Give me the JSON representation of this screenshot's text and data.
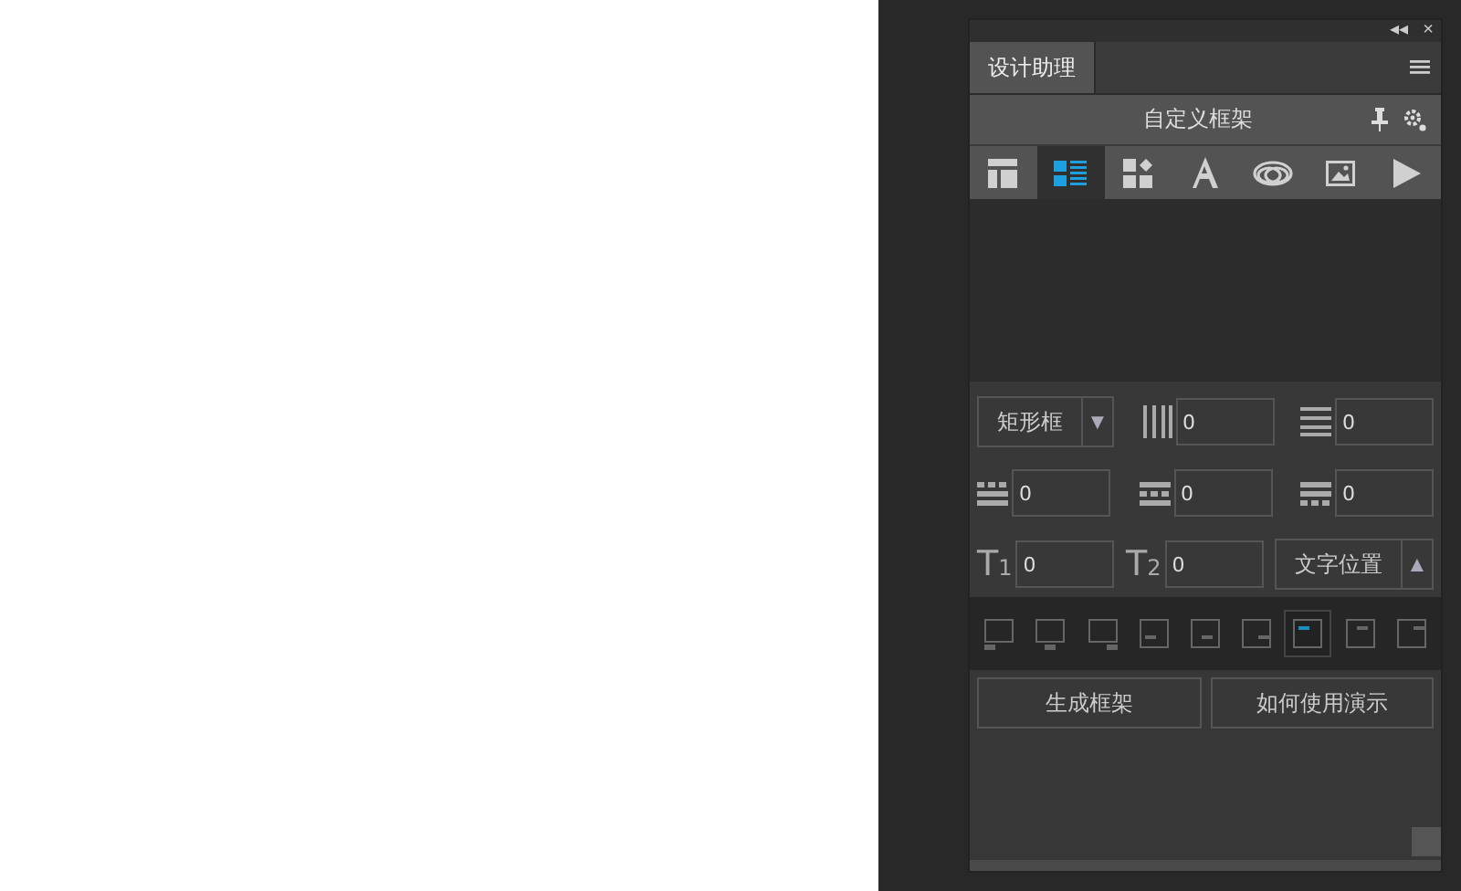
{
  "panel": {
    "collapse": "◂◂",
    "close": "×"
  },
  "tabs": [
    {
      "label": "设计助理",
      "selected": true
    }
  ],
  "title": "自定义框架",
  "tool_tabs": [
    {
      "kind": "layout",
      "selected": false
    },
    {
      "kind": "list",
      "selected": true
    },
    {
      "kind": "widgets",
      "selected": false
    },
    {
      "kind": "text",
      "selected": false
    },
    {
      "kind": "cloud",
      "selected": false
    },
    {
      "kind": "image",
      "selected": false
    },
    {
      "kind": "play",
      "selected": false
    }
  ],
  "form_rows": [
    [
      {
        "kind": "select",
        "value": "矩形框",
        "arrow": "▼"
      },
      {
        "kind": "columns",
        "value": "0"
      },
      {
        "kind": "rows",
        "value": "0"
      }
    ],
    [
      {
        "kind": "dash-top",
        "value": "0"
      },
      {
        "kind": "dash-mid",
        "value": "0"
      },
      {
        "kind": "dash-bottom",
        "value": "0"
      }
    ],
    [
      {
        "kind": "label",
        "label": "T",
        "sub": "1",
        "value": "0"
      },
      {
        "kind": "label",
        "label": "T",
        "sub": "2",
        "value": "0"
      },
      {
        "kind": "select",
        "value": "文字位置",
        "arrow": "▲"
      }
    ]
  ],
  "positions": [
    {
      "kind": "below-left",
      "selected": false
    },
    {
      "kind": "below-center",
      "selected": false
    },
    {
      "kind": "below-right",
      "selected": false
    },
    {
      "kind": "bottom-left",
      "selected": false
    },
    {
      "kind": "bottom-center",
      "selected": false
    },
    {
      "kind": "bottom-right",
      "selected": false
    },
    {
      "kind": "top-left",
      "selected": true
    },
    {
      "kind": "top-center",
      "selected": false
    },
    {
      "kind": "top-right",
      "selected": false
    }
  ],
  "buttons": [
    "生成框架",
    "如何使用演示"
  ]
}
